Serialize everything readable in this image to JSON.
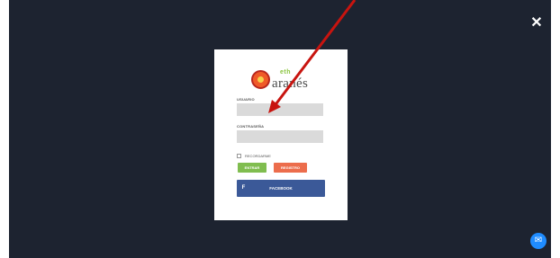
{
  "colors": {
    "overlay": "#1d2330",
    "modal": "#ffffff",
    "enter_button": "#80bd4f",
    "register_button": "#ec6d4c",
    "facebook_button": "#3b5998",
    "arrow": "#c8140f",
    "messenger": "#1f8cff"
  },
  "icons": {
    "close": "close-icon",
    "messenger": "messenger-icon",
    "facebook": "facebook-icon",
    "arrow": "annotation-arrow"
  },
  "login": {
    "logo_top": "eth",
    "logo_main": "aranés",
    "user_label": "USUARIO",
    "user_value": "",
    "user_placeholder": "",
    "password_label": "CONTRASEÑA",
    "password_value": "",
    "password_placeholder": "",
    "remember_label": "RECORDARME",
    "enter_button": "ENTRAR",
    "register_button": "REGISTRO",
    "facebook_button": "FACEBOOK",
    "facebook_icon_glyph": "f"
  },
  "close_glyph": "✕",
  "messenger_glyph": "✉"
}
